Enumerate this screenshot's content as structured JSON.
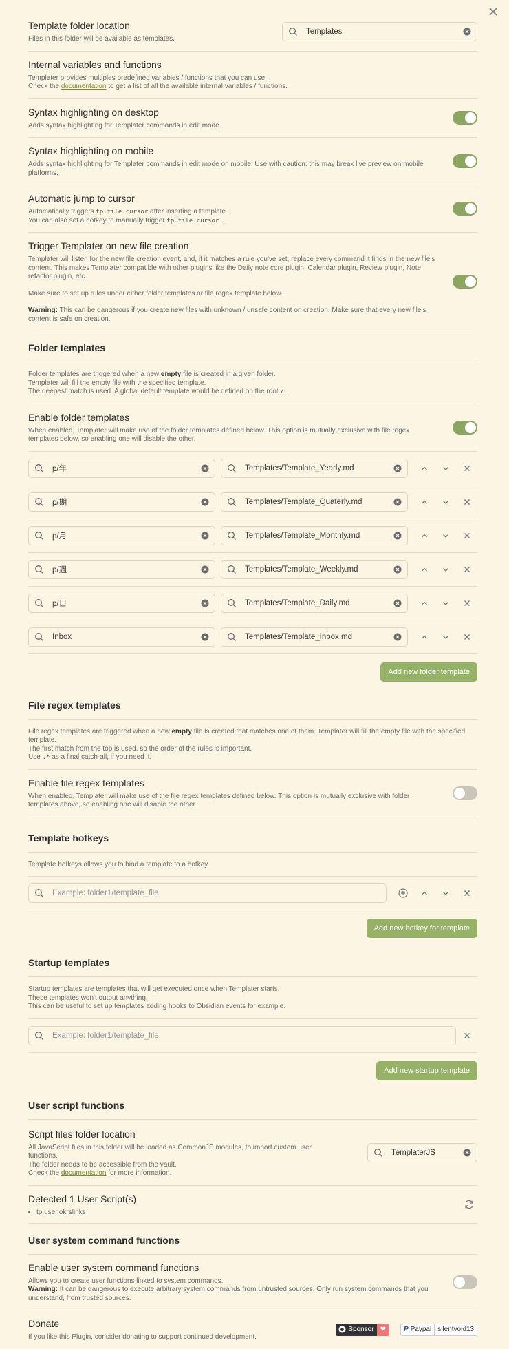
{
  "template_folder": {
    "name": "Template folder location",
    "desc": "Files in this folder will be available as templates.",
    "value": "Templates"
  },
  "internal_vars": {
    "name": "Internal variables and functions",
    "desc1": "Templater provides multiples predefined variables / functions that you can use.",
    "desc2a": "Check the",
    "link": "documentation",
    "desc2b": "to get a list of all the available internal variables / functions."
  },
  "syntax_desktop": {
    "name": "Syntax highlighting on desktop",
    "desc": "Adds syntax highlighting for Templater commands in edit mode."
  },
  "syntax_mobile": {
    "name": "Syntax highlighting on mobile",
    "desc": "Adds syntax highlighting for Templater commands in edit mode on mobile. Use with caution: this may break live preview on mobile platforms."
  },
  "auto_jump": {
    "name": "Automatic jump to cursor",
    "desc1a": "Automatically triggers",
    "code1": "tp.file.cursor",
    "desc1b": "after inserting a template.",
    "desc2a": "You can also set a hotkey to manually trigger",
    "code2": "tp.file.cursor",
    "desc2b": "."
  },
  "trigger_new": {
    "name": "Trigger Templater on new file creation",
    "desc1": "Templater will listen for the new file creation event, and, if it matches a rule you've set, replace every command it finds in the new file's content. This makes Templater compatible with other plugins like the Daily note core plugin, Calendar plugin, Review plugin, Note refactor plugin, etc.",
    "desc2": "Make sure to set up rules under either folder templates or file regex template below.",
    "warning_label": "Warning:",
    "desc3": "This can be dangerous if you create new files with unknown / unsafe content on creation. Make sure that every new file's content is safe on creation."
  },
  "folder_templates": {
    "heading": "Folder templates",
    "desc1a": "Folder templates are triggered when a new",
    "desc1_bold": "empty",
    "desc1b": "file is created in a given folder.",
    "desc2": "Templater will fill the empty file with the specified template.",
    "desc3a": "The deepest match is used. A global default template would be defined on the root",
    "desc3_code": "/",
    "desc3b": ".",
    "enable_name": "Enable folder templates",
    "enable_desc": "When enabled, Templater will make use of the folder templates defined below. This option is mutually exclusive with file regex templates below, so enabling one will disable the other.",
    "rows": [
      {
        "folder": "p/年",
        "template": "Templates/Template_Yearly.md"
      },
      {
        "folder": "p/期",
        "template": "Templates/Template_Quaterly.md"
      },
      {
        "folder": "p/月",
        "template": "Templates/Template_Monthly.md"
      },
      {
        "folder": "p/週",
        "template": "Templates/Template_Weekly.md"
      },
      {
        "folder": "p/日",
        "template": "Templates/Template_Daily.md"
      },
      {
        "folder": "Inbox",
        "template": "Templates/Template_Inbox.md"
      }
    ],
    "add_button": "Add new folder template"
  },
  "file_regex": {
    "heading": "File regex templates",
    "desc1a": "File regex templates are triggered when a new",
    "desc1_bold": "empty",
    "desc1b": "file is created that matches one of them. Templater will fill the empty file with the specified template.",
    "desc2": "The first match from the top is used, so the order of the rules is important.",
    "desc3a": "Use",
    "desc3_code": ".*",
    "desc3b": "as a final catch-all, if you need it.",
    "enable_name": "Enable file regex templates",
    "enable_desc": "When enabled, Templater will make use of the file regex templates defined below. This option is mutually exclusive with folder templates above, so enabling one will disable the other."
  },
  "hotkeys": {
    "heading": "Template hotkeys",
    "desc": "Template hotkeys allows you to bind a template to a hotkey.",
    "placeholder": "Example: folder1/template_file",
    "add_button": "Add new hotkey for template"
  },
  "startup": {
    "heading": "Startup templates",
    "desc1": "Startup templates are templates that will get executed once when Templater starts.",
    "desc2": "These templates won't output anything.",
    "desc3": "This can be useful to set up templates adding hooks to Obsidian events for example.",
    "placeholder": "Example: folder1/template_file",
    "add_button": "Add new startup template"
  },
  "user_scripts": {
    "heading": "User script functions",
    "folder_name": "Script files folder location",
    "folder_desc1": "All JavaScript files in this folder will be loaded as CommonJS modules, to import custom user functions.",
    "folder_desc2": "The folder needs to be accessible from the vault.",
    "folder_desc3a": "Check the",
    "folder_link": "documentation",
    "folder_desc3b": "for more information.",
    "folder_value": "TemplaterJS",
    "detected_name": "Detected 1 User Script(s)",
    "scripts": [
      "tp.user.okrslinks"
    ]
  },
  "system_cmds": {
    "heading": "User system command functions",
    "enable_name": "Enable user system command functions",
    "desc1": "Allows you to create user functions linked to system commands.",
    "warning_label": "Warning:",
    "desc2": "It can be dangerous to execute arbitrary system commands from untrusted sources. Only run system commands that you understand, from trusted sources."
  },
  "donate": {
    "name": "Donate",
    "desc": "If you like this Plugin, consider donating to support continued development.",
    "sponsor_label": "Sponsor",
    "paypal_label": "Paypal",
    "paypal_user": "silentvoid13"
  },
  "toggles": {
    "syntax_desktop": true,
    "syntax_mobile": true,
    "auto_jump": true,
    "trigger_new": true,
    "folder_templates": true,
    "file_regex": false,
    "system_cmds": false
  },
  "colors": {
    "background": "#fcf5e4",
    "accent": "#95b266",
    "toggle_on": "#8aa660",
    "link": "#7a8a2c"
  }
}
